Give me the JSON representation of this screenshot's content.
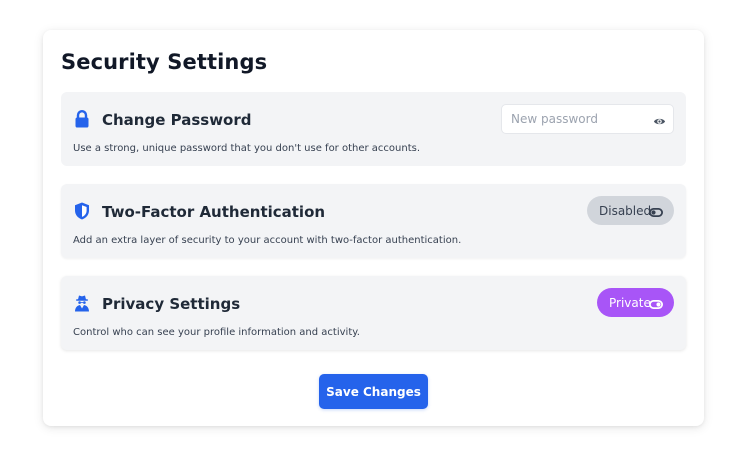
{
  "page": {
    "title": "Security Settings"
  },
  "sections": [
    {
      "icon": "lock-icon",
      "title": "Change Password",
      "description": "Use a strong, unique password that you don't use for other accounts.",
      "control": {
        "type": "password-input",
        "value": "",
        "placeholder": "New password",
        "trailing_icon": "eye-icon"
      }
    },
    {
      "icon": "shield-icon",
      "title": "Two-Factor Authentication",
      "description": "Add an extra layer of security to your account with two-factor authentication.",
      "control": {
        "type": "toggle",
        "label": "Disabled",
        "state": "off",
        "trailing_icon": "toggle-off-icon"
      }
    },
    {
      "icon": "user-secret-icon",
      "title": "Privacy Settings",
      "description": "Control who can see your profile information and activity.",
      "control": {
        "type": "toggle",
        "label": "Private",
        "state": "on",
        "trailing_icon": "toggle-on-icon"
      }
    }
  ],
  "actions": {
    "save_label": "Save Changes"
  },
  "colors": {
    "accent": "#2563eb",
    "private": "#a855f7",
    "disabled": "#d1d5db",
    "section_bg": "#f3f4f6"
  }
}
